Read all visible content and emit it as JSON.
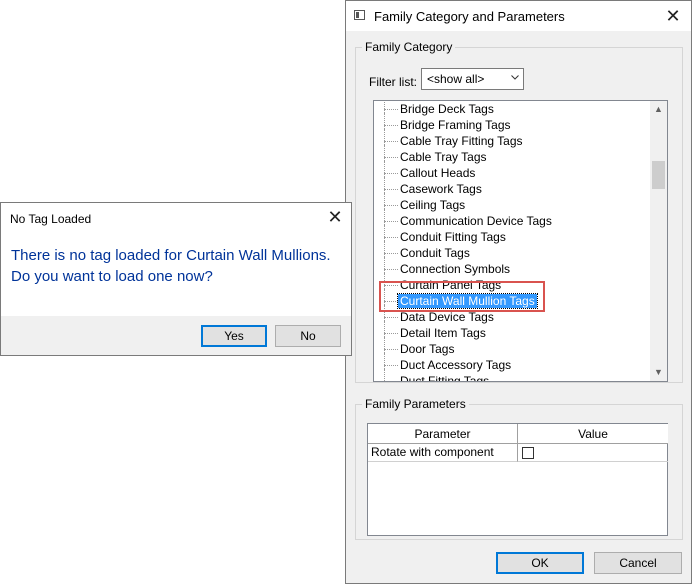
{
  "family_dialog": {
    "title": "Family Category and Parameters",
    "category_group_label": "Family Category",
    "filter_label": "Filter list:",
    "filter_value": "<show all>",
    "categories": [
      "Bridge Deck Tags",
      "Bridge Framing Tags",
      "Cable Tray Fitting Tags",
      "Cable Tray Tags",
      "Callout Heads",
      "Casework Tags",
      "Ceiling Tags",
      "Communication Device Tags",
      "Conduit Fitting Tags",
      "Conduit Tags",
      "Connection Symbols",
      "Curtain Panel Tags",
      "Curtain Wall Mullion Tags",
      "Data Device Tags",
      "Detail Item Tags",
      "Door Tags",
      "Duct Accessory Tags",
      "Duct Fitting Tags"
    ],
    "selected_category": "Curtain Wall Mullion Tags",
    "parameters_group_label": "Family Parameters",
    "table_headers": {
      "parameter": "Parameter",
      "value": "Value"
    },
    "parameters": [
      {
        "name": "Rotate with component",
        "checked": false
      }
    ],
    "ok_label": "OK",
    "cancel_label": "Cancel"
  },
  "no_tag_dialog": {
    "title": "No Tag Loaded",
    "message": "There is no tag loaded for Curtain Wall Mullions. Do you want to load one now?",
    "yes_label": "Yes",
    "no_label": "No"
  },
  "colors": {
    "selection": "#3399ff",
    "highlight_outline": "#d9534f",
    "message_text": "#003399"
  }
}
